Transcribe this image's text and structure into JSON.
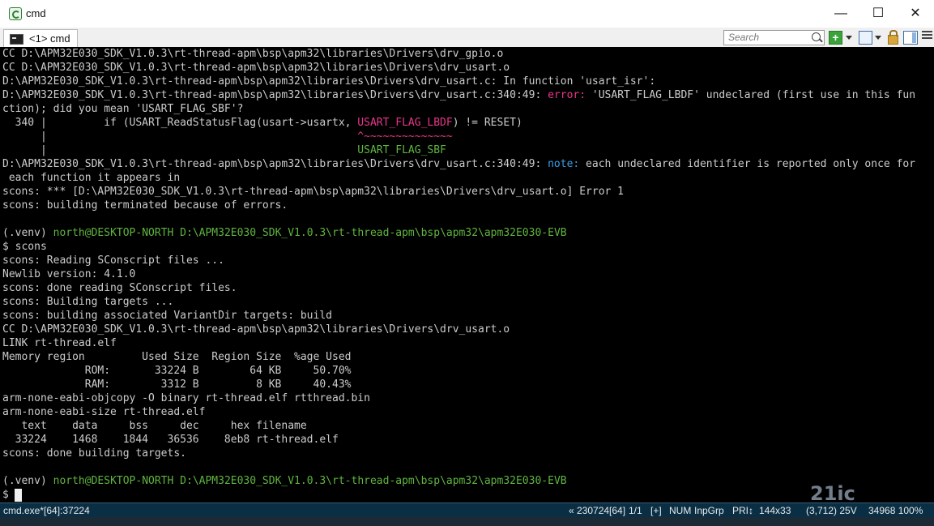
{
  "window": {
    "title": "cmd",
    "minimize": "—",
    "maximize": "☐",
    "close": "✕"
  },
  "tabs": [
    {
      "label": "<1> cmd"
    }
  ],
  "toolbar": {
    "search_placeholder": "Search",
    "add": "+"
  },
  "console": {
    "lines": [
      "CC D:\\APM32E030_SDK_V1.0.3\\rt-thread-apm\\bsp\\apm32\\libraries\\Drivers\\drv_gpio.o",
      "CC D:\\APM32E030_SDK_V1.0.3\\rt-thread-apm\\bsp\\apm32\\libraries\\Drivers\\drv_usart.o",
      "D:\\APM32E030_SDK_V1.0.3\\rt-thread-apm\\bsp\\apm32\\libraries\\Drivers\\drv_usart.c: In function 'usart_isr':",
      "D:\\APM32E030_SDK_V1.0.3\\rt-thread-apm\\bsp\\apm32\\libraries\\Drivers\\drv_usart.c:340:49: ",
      "error:",
      " 'USART_FLAG_LBDF' undeclared (first use in this fun",
      "ction); did you mean 'USART_FLAG_SBF'?",
      "  340 |         if (USART_ReadStatusFlag(usart->usartx, ",
      "USART_FLAG_LBDF",
      ") != RESET)",
      "      |                                                 ",
      "^~~~~~~~~~~~~~~",
      "      |                                                 ",
      "USART_FLAG_SBF",
      "D:\\APM32E030_SDK_V1.0.3\\rt-thread-apm\\bsp\\apm32\\libraries\\Drivers\\drv_usart.c:340:49: ",
      "note:",
      " each undeclared identifier is reported only once for",
      " each function it appears in",
      "scons: *** [D:\\APM32E030_SDK_V1.0.3\\rt-thread-apm\\bsp\\apm32\\libraries\\Drivers\\drv_usart.o] Error 1",
      "scons: building terminated because of errors.",
      "(.venv) ",
      "north@DESKTOP-NORTH",
      " D:\\APM32E030_SDK_V1.0.3\\rt-thread-apm\\bsp\\apm32\\apm32E030-EVB",
      "$ scons",
      "scons: Reading SConscript files ...",
      "Newlib version: 4.1.0",
      "scons: done reading SConscript files.",
      "scons: Building targets ...",
      "scons: building associated VariantDir targets: build",
      "CC D:\\APM32E030_SDK_V1.0.3\\rt-thread-apm\\bsp\\apm32\\libraries\\Drivers\\drv_usart.o",
      "LINK rt-thread.elf",
      "Memory region         Used Size  Region Size  %age Used",
      "             ROM:       33224 B        64 KB     50.70%",
      "             RAM:        3312 B         8 KB     40.43%",
      "arm-none-eabi-objcopy -O binary rt-thread.elf rtthread.bin",
      "arm-none-eabi-size rt-thread.elf",
      "   text    data     bss     dec     hex filename",
      "  33224    1468    1844   36536    8eb8 rt-thread.elf",
      "scons: done building targets.",
      "(.venv) ",
      "north@DESKTOP-NORTH",
      " D:\\APM32E030_SDK_V1.0.3\\rt-thread-apm\\bsp\\apm32\\apm32E030-EVB",
      "$ "
    ]
  },
  "statusbar": {
    "process": "cmd.exe*[64]:37224",
    "pos": "« 230724[64]",
    "page": "1/1",
    "plus": "[+]",
    "num": "NUM",
    "inp": "InpGrp",
    "pri": "PRI↕",
    "size": "144x33",
    "coords": "(3,712) 25V",
    "right": "34968 100%"
  },
  "watermark": "21ic"
}
